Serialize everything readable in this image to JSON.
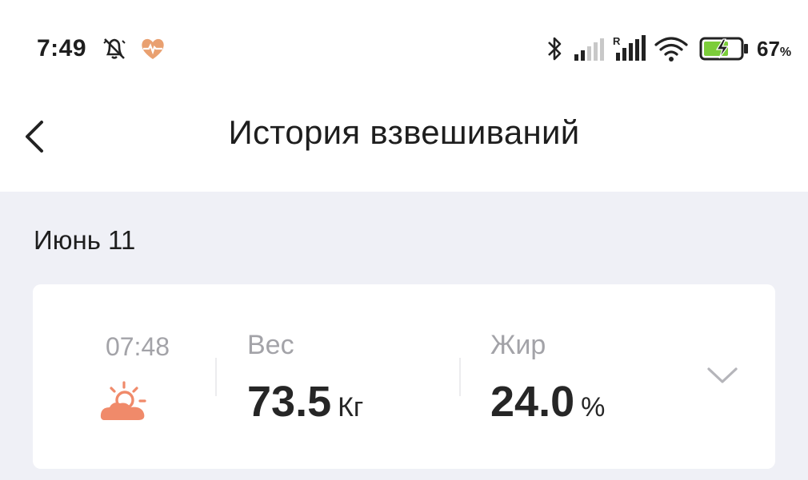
{
  "status_bar": {
    "time": "7:49",
    "battery_percent": "67",
    "battery_percent_sign": "%",
    "icons": [
      "silent-alarm-icon",
      "heart-rate-icon",
      "bluetooth-icon",
      "signal-icon",
      "roaming-signal-icon",
      "wifi-icon",
      "battery-charging-icon"
    ],
    "roaming_label": "R"
  },
  "header": {
    "title": "История взвешиваний",
    "back_icon": "chevron-left-icon"
  },
  "history": {
    "date": "Июнь 11",
    "entries": [
      {
        "time": "07:48",
        "time_of_day_icon": "sunrise-icon",
        "weight_label": "Вес",
        "weight_value": "73.5",
        "weight_unit": "Кг",
        "fat_label": "Жир",
        "fat_value": "24.0",
        "fat_unit": "%",
        "expand_icon": "chevron-down-icon"
      }
    ]
  },
  "colors": {
    "background": "#eff0f6",
    "card": "#ffffff",
    "accent_orange": "#f08a6a",
    "muted_text": "#a3a3a8",
    "battery_green": "#7ccd3a"
  }
}
